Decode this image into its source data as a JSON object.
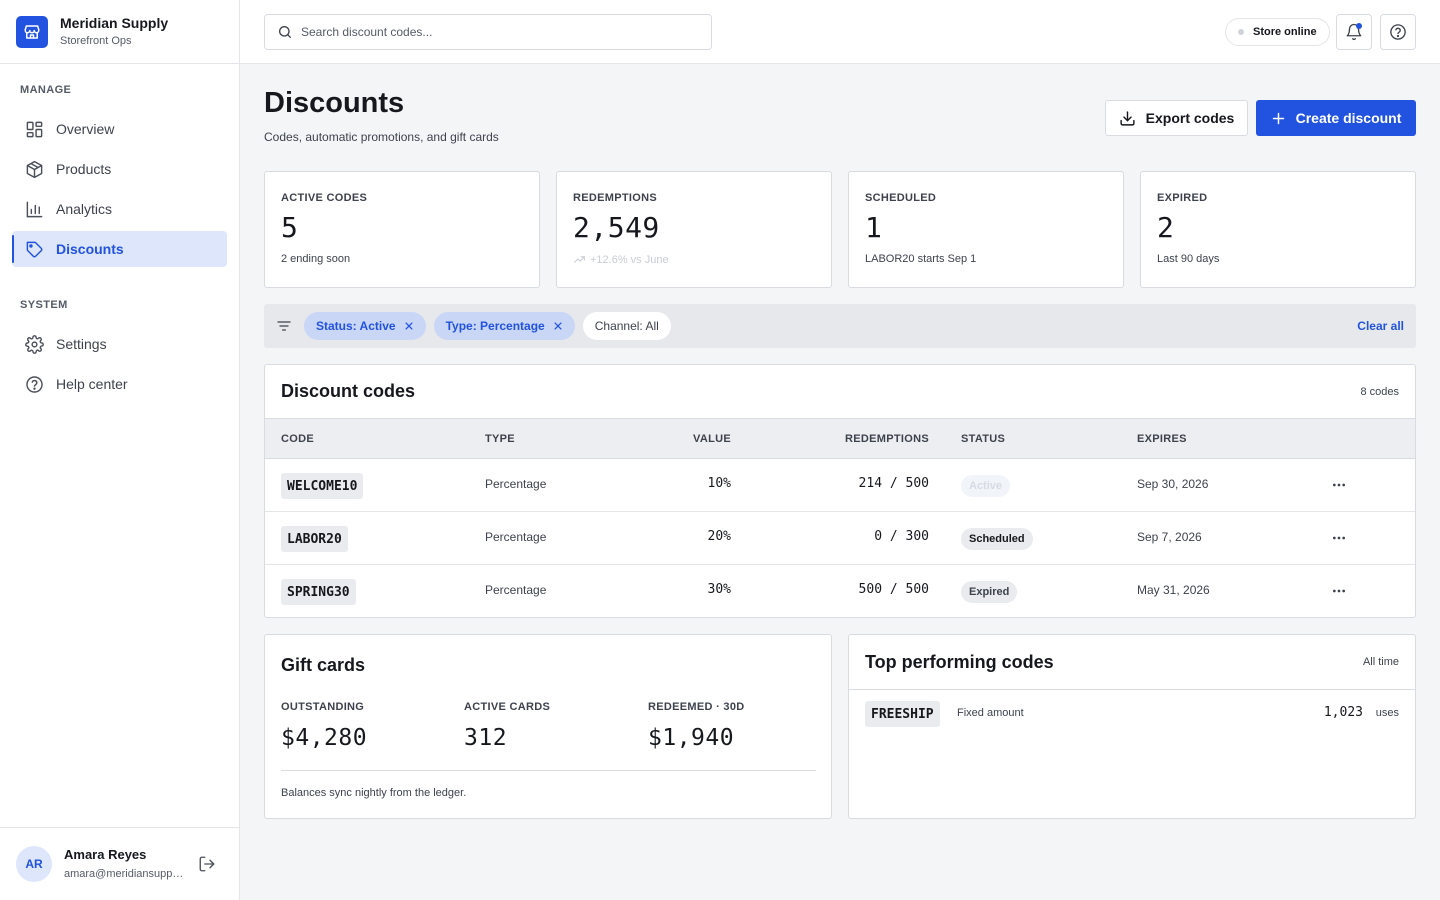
{
  "brand": {
    "name": "Meridian Supply",
    "subtitle": "Storefront Ops"
  },
  "sidebar": {
    "sections": [
      {
        "label": "MANAGE"
      },
      {
        "label": "SYSTEM"
      }
    ],
    "items": [
      {
        "label": "Overview",
        "icon": "grid-icon"
      },
      {
        "label": "Products",
        "icon": "box-icon"
      },
      {
        "label": "Analytics",
        "icon": "bar-chart-icon"
      },
      {
        "label": "Discounts",
        "icon": "tag-icon",
        "active": true
      },
      {
        "label": "Settings",
        "icon": "gear-icon"
      },
      {
        "label": "Help center",
        "icon": "help-icon"
      }
    ]
  },
  "user": {
    "initials": "AR",
    "name": "Amara Reyes",
    "email": "amara@meridiansupply.com"
  },
  "topbar": {
    "search_placeholder": "Search discount codes...",
    "store_status": "Store online"
  },
  "page": {
    "title": "Discounts",
    "subtitle": "Codes, automatic promotions, and gift cards",
    "export_label": "Export codes",
    "create_label": "Create discount"
  },
  "stats": [
    {
      "label": "ACTIVE CODES",
      "value": "5",
      "note": "2 ending soon"
    },
    {
      "label": "REDEMPTIONS",
      "value": "2,549",
      "note": "+12.6% vs June"
    },
    {
      "label": "SCHEDULED",
      "value": "1",
      "note": "LABOR20 starts Sep 1"
    },
    {
      "label": "EXPIRED",
      "value": "2",
      "note": "Last 90 days"
    }
  ],
  "filters": {
    "chips": [
      {
        "label": "Status: Active",
        "removable": true
      },
      {
        "label": "Type: Percentage",
        "removable": true
      },
      {
        "label": "Channel: All",
        "removable": false
      }
    ],
    "clear_label": "Clear all"
  },
  "table": {
    "title": "Discount codes",
    "count": "8 codes",
    "columns": [
      "CODE",
      "TYPE",
      "VALUE",
      "REDEMPTIONS",
      "STATUS",
      "EXPIRES"
    ],
    "rows": [
      {
        "code": "WELCOME10",
        "type": "Percentage",
        "value": "10%",
        "redemptions": "214 / 500",
        "status": "Active",
        "expires": "Sep 30, 2026"
      },
      {
        "code": "LABOR20",
        "type": "Percentage",
        "value": "20%",
        "redemptions": "0 / 300",
        "status": "Scheduled",
        "expires": "Sep 7, 2026"
      },
      {
        "code": "SPRING30",
        "type": "Percentage",
        "value": "30%",
        "redemptions": "500 / 500",
        "status": "Expired",
        "expires": "May 31, 2026"
      }
    ]
  },
  "gift_cards": {
    "title": "Gift cards",
    "metrics": [
      {
        "label": "OUTSTANDING",
        "value": "$4,280"
      },
      {
        "label": "ACTIVE CARDS",
        "value": "312"
      },
      {
        "label": "REDEEMED · 30D",
        "value": "$1,940"
      }
    ],
    "note": "Balances sync nightly from the ledger."
  },
  "top_codes": {
    "title": "Top performing codes",
    "range": "All time",
    "rows": [
      {
        "code": "FREESHIP",
        "type": "Fixed amount",
        "uses": "1,023",
        "uses_label": "uses"
      }
    ]
  },
  "colors": {
    "accent": "#2252e0",
    "accent_soft": "#dde6fb",
    "border": "#d8dbe0",
    "background": "#f4f5f7"
  }
}
